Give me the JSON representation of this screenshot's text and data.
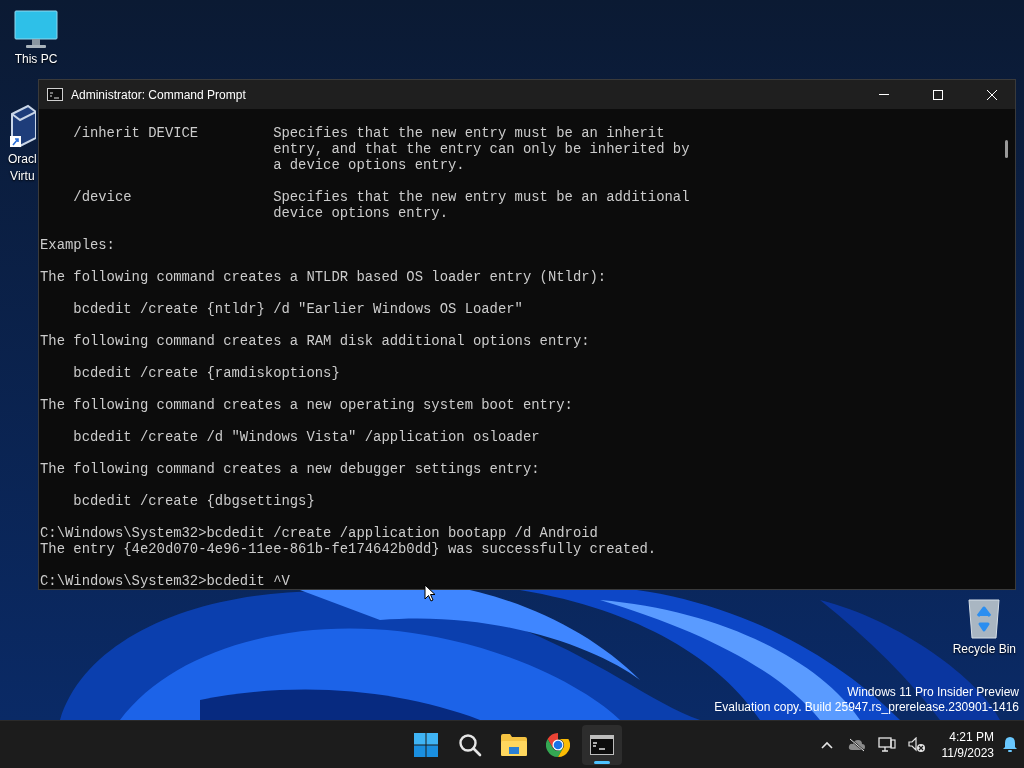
{
  "desktop": {
    "icons": [
      {
        "kind": "computer",
        "lines": [
          "This PC"
        ]
      },
      {
        "kind": "virtualbox",
        "lines": [
          "Oracl",
          "Virtu"
        ]
      }
    ],
    "recycle_bin": {
      "label": "Recycle Bin"
    },
    "watermark": [
      "Windows 11 Pro Insider Preview",
      "Evaluation copy. Build 25947.rs_prerelease.230901-1416"
    ]
  },
  "window": {
    "title": "Administrator: Command Prompt",
    "console": [
      [
        "    /inherit DEVICE         Specifies that the new entry must be an inherit",
        "                            entry, and that the entry can only be inherited by",
        "                            a device options entry."
      ],
      [
        "    /device                 Specifies that the new entry must be an additional",
        "                            device options entry."
      ],
      [
        "Examples:"
      ],
      [
        "The following command creates a NTLDR based OS loader entry (Ntldr):"
      ],
      [
        "    bcdedit /create {ntldr} /d \"Earlier Windows OS Loader\""
      ],
      [
        "The following command creates a RAM disk additional options entry:"
      ],
      [
        "    bcdedit /create {ramdiskoptions}"
      ],
      [
        "The following command creates a new operating system boot entry:"
      ],
      [
        "    bcdedit /create /d \"Windows Vista\" /application osloader"
      ],
      [
        "The following command creates a new debugger settings entry:"
      ],
      [
        "    bcdedit /create {dbgsettings}"
      ],
      [
        "C:\\Windows\\System32>bcdedit /create /application bootapp /d Android",
        "The entry {4e20d070-4e96-11ee-861b-fe174642b0dd} was successfully created."
      ],
      [
        "C:\\Windows\\System32>bcdedit ^V"
      ]
    ]
  },
  "taskbar": {
    "apps": [
      {
        "kind": "start",
        "active": false
      },
      {
        "kind": "search",
        "active": false
      },
      {
        "kind": "explorer",
        "active": false
      },
      {
        "kind": "chrome",
        "active": false
      },
      {
        "kind": "terminal",
        "active": true
      }
    ],
    "tray": [
      {
        "kind": "chevron"
      },
      {
        "kind": "cloud-off"
      },
      {
        "kind": "network"
      },
      {
        "kind": "volume-muted"
      }
    ],
    "time": "4:21 PM",
    "date": "11/9/2023"
  }
}
